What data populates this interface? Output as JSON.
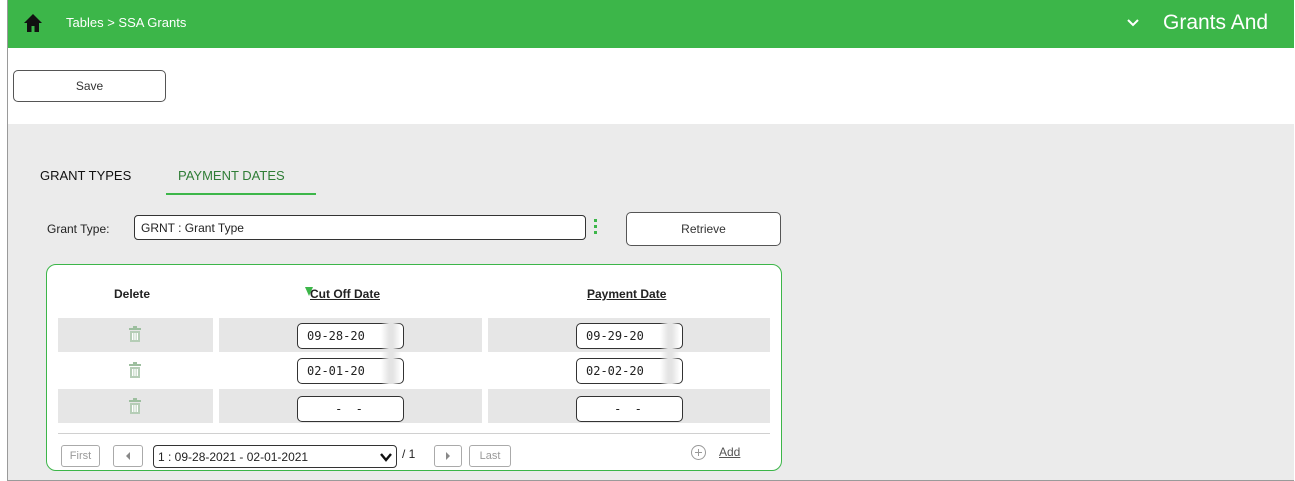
{
  "header": {
    "breadcrumb": "Tables > SSA Grants",
    "app_title": "Grants And",
    "bar_color": "#3cb649"
  },
  "toolbar": {
    "save_label": "Save"
  },
  "tabs": [
    {
      "label": "GRANT TYPES",
      "active": false
    },
    {
      "label": "PAYMENT DATES",
      "active": true
    }
  ],
  "filter": {
    "grant_type_label": "Grant Type:",
    "grant_type_value": "GRNT : Grant Type",
    "retrieve_label": "Retrieve"
  },
  "grid": {
    "columns": [
      "Delete",
      "Cut Off Date",
      "Payment Date"
    ],
    "rows": [
      {
        "cut_off": "09-28-20",
        "payment": "09-29-20"
      },
      {
        "cut_off": "02-01-20",
        "payment": "02-02-20"
      },
      {
        "cut_off": "- -",
        "payment": "- -"
      }
    ]
  },
  "pager": {
    "first": "First",
    "last": "Last",
    "current_page": "1 : 09-28-2021 - 02-01-2021",
    "total": "/ 1",
    "add_label": "Add"
  }
}
